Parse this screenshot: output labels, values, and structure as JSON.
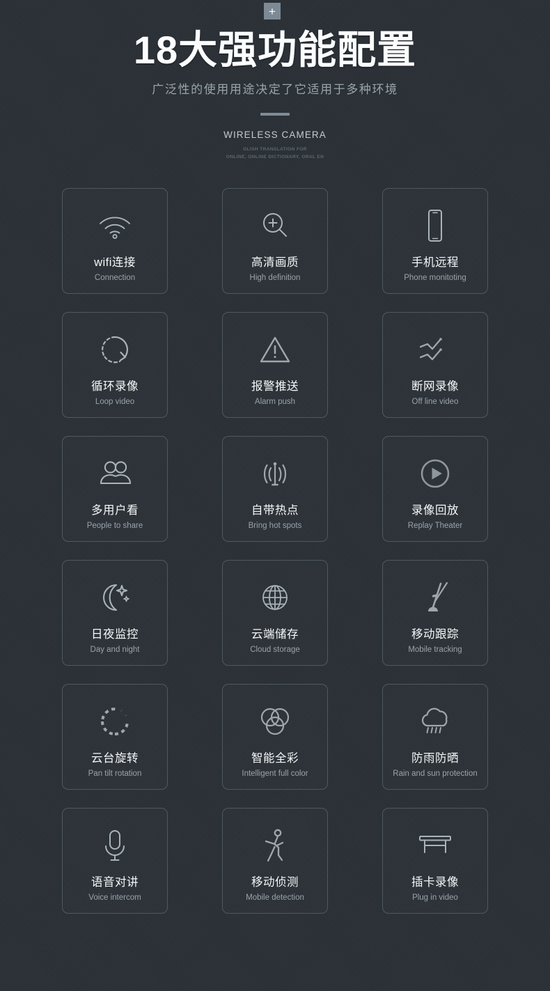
{
  "top_badge": {
    "icon": "plus-icon",
    "label": "+"
  },
  "header": {
    "title": "18大强功能配置",
    "subtitle": "广泛性的使用用途决定了它适用于多种环境",
    "brand": "WIRELESS CAMERA",
    "tiny_line1": "GLISH TRANSLATION FOR",
    "tiny_line2": "ONLINE, ONLINE DICTIONARY, ORAL EN"
  },
  "colors": {
    "background": "#2b3137",
    "card_border": "#a0afb9",
    "title": "#fbfdfe",
    "subtitle": "#9aa4ac",
    "divider": "#7e8c98",
    "badge": "#7d8a95",
    "icon_stroke": "#aab3ba",
    "card_label": "#f4f7f8",
    "card_sub": "#9aa3ab"
  },
  "features": [
    {
      "icon": "wifi-icon",
      "label": "wifi连接",
      "sub": "Connection"
    },
    {
      "icon": "magnifier-plus-icon",
      "label": "高清画质",
      "sub": "High definition"
    },
    {
      "icon": "smartphone-icon",
      "label": "手机远程",
      "sub": "Phone monitoting"
    },
    {
      "icon": "loop-arrow-icon",
      "label": "循环录像",
      "sub": "Loop video"
    },
    {
      "icon": "warning-triangle-icon",
      "label": "报警推送",
      "sub": "Alarm push"
    },
    {
      "icon": "broken-line-icon",
      "label": "断网录像",
      "sub": "Off line video"
    },
    {
      "icon": "two-people-icon",
      "label": "多用户看",
      "sub": "People to share"
    },
    {
      "icon": "antenna-waves-icon",
      "label": "自带热点",
      "sub": "Bring hot spots"
    },
    {
      "icon": "play-circle-icon",
      "label": "录像回放",
      "sub": "Replay Theater"
    },
    {
      "icon": "moon-stars-icon",
      "label": "日夜监控",
      "sub": "Day and night"
    },
    {
      "icon": "globe-grid-icon",
      "label": "云端储存",
      "sub": "Cloud storage"
    },
    {
      "icon": "tracking-antenna-icon",
      "label": "移动跟踪",
      "sub": "Mobile tracking"
    },
    {
      "icon": "dashed-spinner-icon",
      "label": "云台旋转",
      "sub": "Pan tilt rotation"
    },
    {
      "icon": "venn-circles-icon",
      "label": "智能全彩",
      "sub": "Intelligent full color"
    },
    {
      "icon": "rain-cloud-icon",
      "label": "防雨防晒",
      "sub": "Rain and sun protection"
    },
    {
      "icon": "microphone-icon",
      "label": "语音对讲",
      "sub": "Voice intercom"
    },
    {
      "icon": "walking-person-icon",
      "label": "移动侦测",
      "sub": "Mobile detection"
    },
    {
      "icon": "card-slot-icon",
      "label": "插卡录像",
      "sub": "Plug in video"
    }
  ]
}
